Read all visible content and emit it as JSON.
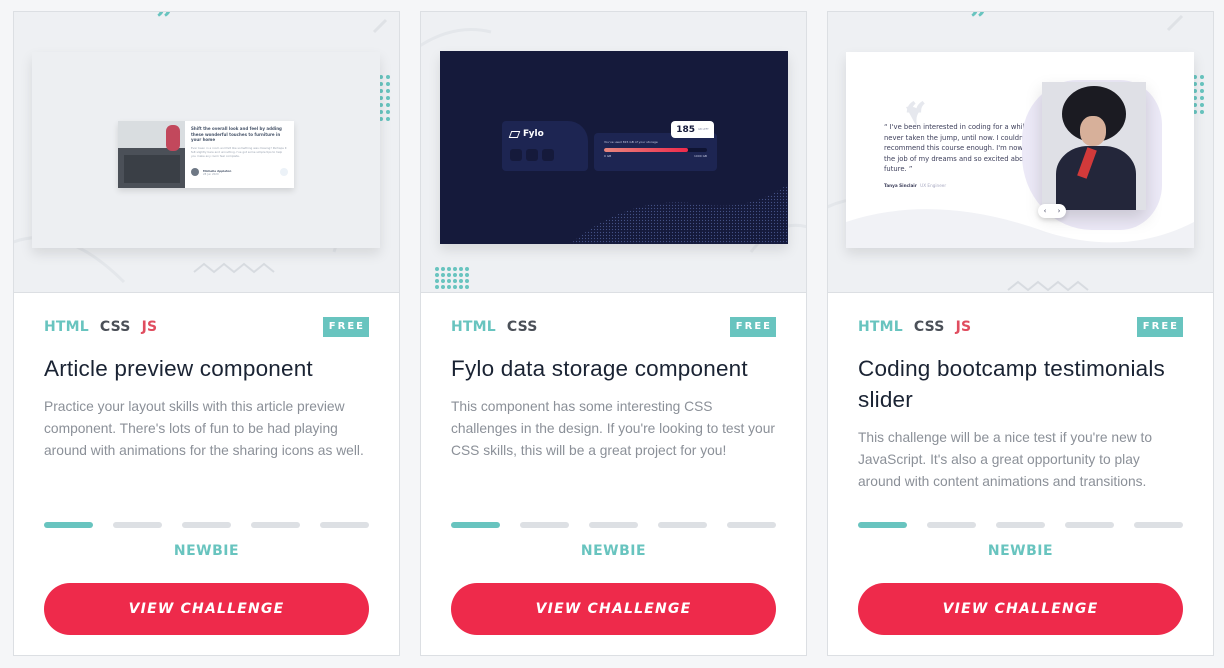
{
  "colors": {
    "accent_teal": "#68c4bf",
    "cta_red": "#ee2a4b",
    "js_red": "#e04d5f",
    "css_gray": "#4b5058",
    "title_navy": "#1a2333"
  },
  "cards": [
    {
      "tags": [
        "HTML",
        "CSS",
        "JS"
      ],
      "badge": "FREE",
      "title": "Article preview component",
      "description": "Practice your layout skills with this article preview component. There's lots of fun to be had playing around with animations for the sharing icons as well.",
      "level": "NEWBIE",
      "level_value": 1,
      "level_max": 5,
      "cta": "VIEW CHALLENGE",
      "preview": {
        "heading": "Shift the overall look and feel by adding these wonderful touches to furniture in your home",
        "body": "Ever been in a room and felt like something was missing? Perhaps it felt slightly bare and uninviting. I've got some simple tips to help you make any room feel complete.",
        "author": "Michelle Appleton",
        "date": "28 Jun 2020"
      }
    },
    {
      "tags": [
        "HTML",
        "CSS"
      ],
      "badge": "FREE",
      "title": "Fylo data storage component",
      "description": "This component has some interesting CSS challenges in the design. If you're looking to test your CSS skills, this will be a great project for you!",
      "level": "NEWBIE",
      "level_value": 1,
      "level_max": 5,
      "cta": "VIEW CHALLENGE",
      "preview": {
        "logo": "Fylo",
        "left_count": "185",
        "left_unit": "GB LEFT",
        "usage_text": "You've used 815 GB of your storage",
        "min_label": "0 GB",
        "max_label": "1000 GB",
        "usage_fraction": 0.815
      }
    },
    {
      "tags": [
        "HTML",
        "CSS",
        "JS"
      ],
      "badge": "FREE",
      "title": "Coding bootcamp testimonials slider",
      "description": "This challenge will be a nice test if you're new to JavaScript. It's also a great opportunity to play around with content animations and transitions.",
      "level": "NEWBIE",
      "level_value": 1,
      "level_max": 5,
      "cta": "VIEW CHALLENGE",
      "preview": {
        "quote": "“ I've been interested in coding for a while but never taken the jump, until now. I couldn't recommend this course enough. I'm now in the job of my dreams and so excited about the future. ”",
        "name": "Tanya Sinclair",
        "role": "UX Engineer"
      }
    }
  ]
}
